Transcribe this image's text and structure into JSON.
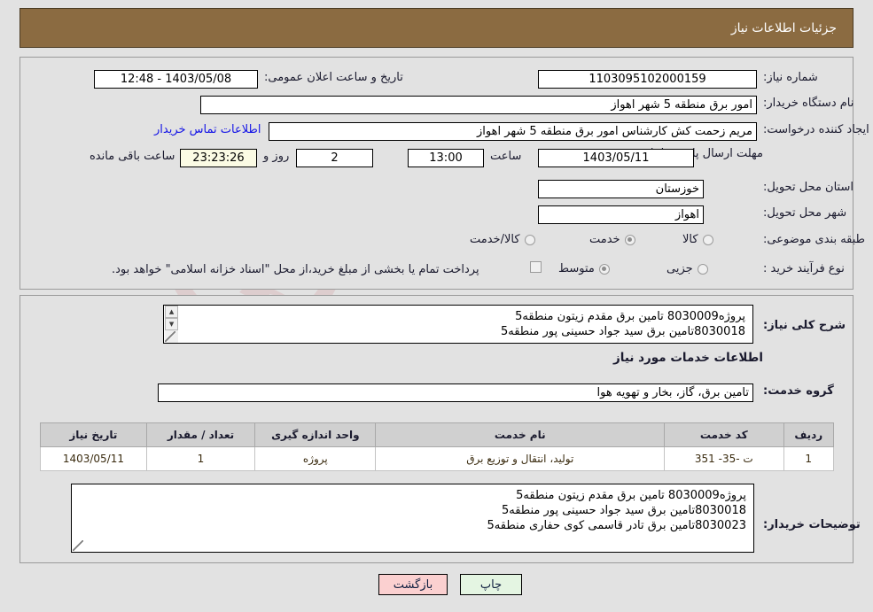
{
  "window": {
    "title": "جزئیات اطلاعات نیاز"
  },
  "top_panel": {
    "fields": {
      "need_number_label": "شماره نیاز:",
      "need_number_value": "1103095102000159",
      "announce_datetime_label": "تاریخ و ساعت اعلان عمومی:",
      "announce_datetime_value": "1403/05/08 - 12:48",
      "buyer_org_label": "نام دستگاه خریدار:",
      "buyer_org_value": "امور برق منطقه 5 شهر اهواز",
      "buyer_org_value2": "",
      "requester_label": "ایجاد کننده درخواست:",
      "requester_value": "مریم زحمت کش کارشناس امور برق منطقه 5 شهر اهواز",
      "contact_link": "اطلاعات تماس خریدار",
      "deadline_label": "مهلت ارسال پاسخ: تا تاریخ:",
      "deadline_date": "1403/05/11",
      "time_label": "ساعت",
      "deadline_time": "13:00",
      "days_value": "2",
      "days_label": "روز و",
      "countdown_value": "23:23:26",
      "remaining_label": "ساعت باقی مانده",
      "province_label": "استان محل تحویل:",
      "province_value": "خوزستان",
      "city_label": "شهر محل تحویل:",
      "city_value": "اهواز",
      "category_label": "طبقه بندی موضوعی:",
      "process_label": "نوع فرآیند خرید :",
      "treasury_note": "پرداخت تمام یا بخشی از مبلغ خرید،از محل \"اسناد خزانه اسلامی\" خواهد بود."
    },
    "category_options": [
      {
        "label": "کالا",
        "selected": false
      },
      {
        "label": "خدمت",
        "selected": true
      },
      {
        "label": "کالا/خدمت",
        "selected": false
      }
    ],
    "process_options": [
      {
        "label": "جزیی",
        "selected": false
      },
      {
        "label": "متوسط",
        "selected": true
      }
    ]
  },
  "bottom_panel": {
    "summary_label": "شرح کلی نیاز:",
    "summary_lines": [
      "پروژه8030009 تامین برق مقدم زیتون منطقه5",
      "8030018تامین برق سید جواد حسینی پور منطقه5"
    ],
    "section_heading": "اطلاعات خدمات مورد نیاز",
    "service_group_label": "گروه خدمت:",
    "service_group_value": "تامین برق، گاز، بخار و تهویه هوا",
    "table": {
      "columns": [
        "ردیف",
        "کد خدمت",
        "نام خدمت",
        "واحد اندازه گیری",
        "تعداد / مقدار",
        "تاریخ نیاز"
      ],
      "rows": [
        {
          "radif": "1",
          "code": "ت -35- 351",
          "name": "تولید، انتقال و توزیع برق",
          "unit": "پروژه",
          "qty": "1",
          "date": "1403/05/11"
        }
      ]
    },
    "buyer_notes_label": "توضیحات خریدار:",
    "buyer_notes_lines": [
      "پروژه8030009 تامین برق مقدم زیتون منطقه5",
      "8030018تامین برق سید جواد حسینی پور منطقه5",
      "8030023تامین برق تادر قاسمی کوی حفاری منطقه5"
    ]
  },
  "footer": {
    "print_label": "چاپ",
    "back_label": "بازگشت"
  },
  "watermark": {
    "text": "AriaTender.net"
  },
  "colors": {
    "title_bar": "#8b6b41",
    "page_background": "#e2e2e2",
    "link": "#1414e6",
    "print_button": "#e4f5e2",
    "back_button": "#fbd0d0",
    "countdown_field": "#fbfbe4",
    "table_header": "#d0d0d0"
  }
}
